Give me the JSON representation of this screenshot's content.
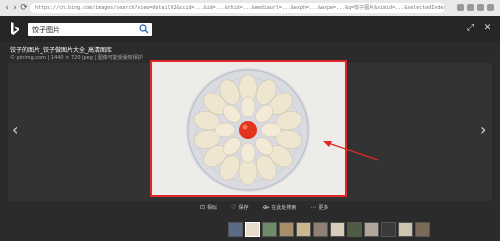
{
  "browser": {
    "address": "https://cn.bing.com/images/search?view=detailV2&ccid=...&id=...&thid=...&mediaurl=...&exph=...&expw=...&q=饺子图片&simid=...&selectedIndex=1&ajaxhist=0",
    "back_icon": "‹",
    "forward_icon": "›",
    "reload_icon": "⟳"
  },
  "search": {
    "query": "饺子图片"
  },
  "image_info": {
    "title": "饺子的图片_饺子做图片大全_高清图库",
    "meta": "© pinimg.com   |   1440 × 720 jpeg   |   图像可能受版权保护"
  },
  "actions": {
    "visual_search": "相似",
    "save": "保存",
    "share": "在此处搜索",
    "more": "更多"
  },
  "thumbs": [
    {
      "color": "#5a6b8a"
    },
    {
      "color": "#e7dccd",
      "active": true
    },
    {
      "color": "#6e8c6a"
    },
    {
      "color": "#a88d6b"
    },
    {
      "color": "#c9b78e"
    },
    {
      "color": "#8e8074"
    },
    {
      "color": "#d7cdb8"
    },
    {
      "color": "#4d5c43"
    },
    {
      "color": "#b0a79a"
    },
    {
      "color": "#3c3a38"
    },
    {
      "color": "#cec4b2"
    },
    {
      "color": "#7a6a58"
    }
  ],
  "colors": {
    "highlight": "#e12626",
    "background": "#2b2b2b"
  }
}
